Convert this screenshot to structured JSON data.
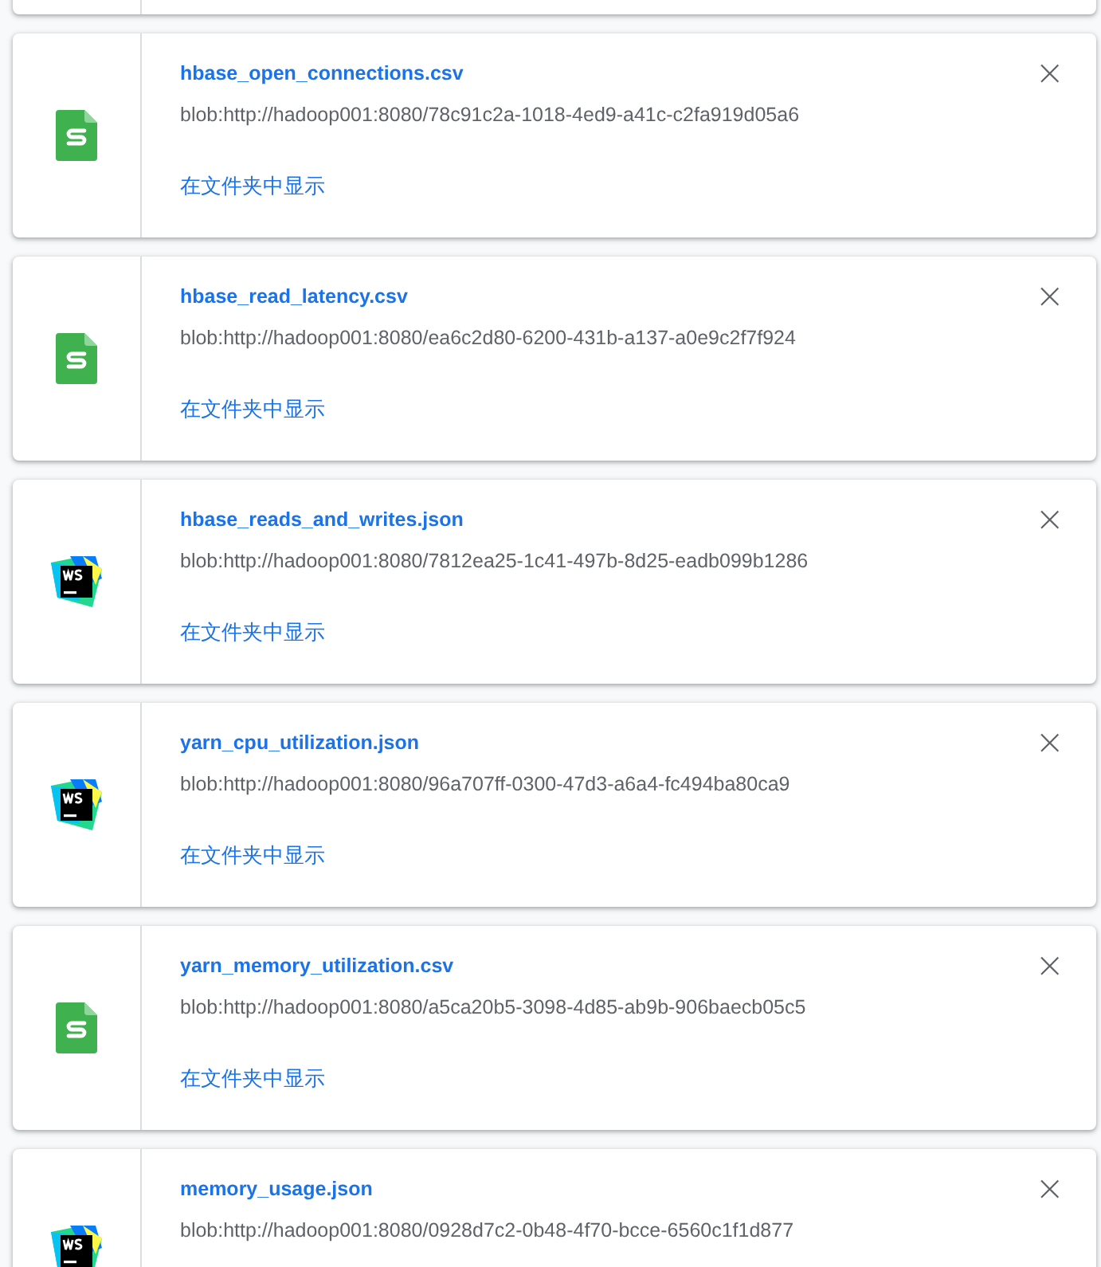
{
  "downloads": [
    {
      "kind": "partial"
    },
    {
      "kind": "sheet",
      "file_name": "hbase_open_connections.csv",
      "url": "blob:http://hadoop001:8080/78c91c2a-1018-4ed9-a41c-c2fa919d05a6",
      "show_in_folder": "在文件夹中显示",
      "remove": "×"
    },
    {
      "kind": "sheet",
      "file_name": "hbase_read_latency.csv",
      "url": "blob:http://hadoop001:8080/ea6c2d80-6200-431b-a137-a0e9c2f7f924",
      "show_in_folder": "在文件夹中显示",
      "remove": "×"
    },
    {
      "kind": "webstorm",
      "file_name": "hbase_reads_and_writes.json",
      "url": "blob:http://hadoop001:8080/7812ea25-1c41-497b-8d25-eadb099b1286",
      "show_in_folder": "在文件夹中显示",
      "remove": "×"
    },
    {
      "kind": "webstorm",
      "file_name": "yarn_cpu_utilization.json",
      "url": "blob:http://hadoop001:8080/96a707ff-0300-47d3-a6a4-fc494ba80ca9",
      "show_in_folder": "在文件夹中显示",
      "remove": "×"
    },
    {
      "kind": "sheet",
      "file_name": "yarn_memory_utilization.csv",
      "url": "blob:http://hadoop001:8080/a5ca20b5-3098-4d85-ab9b-906baecb05c5",
      "show_in_folder": "在文件夹中显示",
      "remove": "×"
    },
    {
      "kind": "webstorm",
      "file_name": "memory_usage.json",
      "url": "blob:http://hadoop001:8080/0928d7c2-0b48-4f70-bcce-6560c1f1d877",
      "remove": "×"
    }
  ]
}
